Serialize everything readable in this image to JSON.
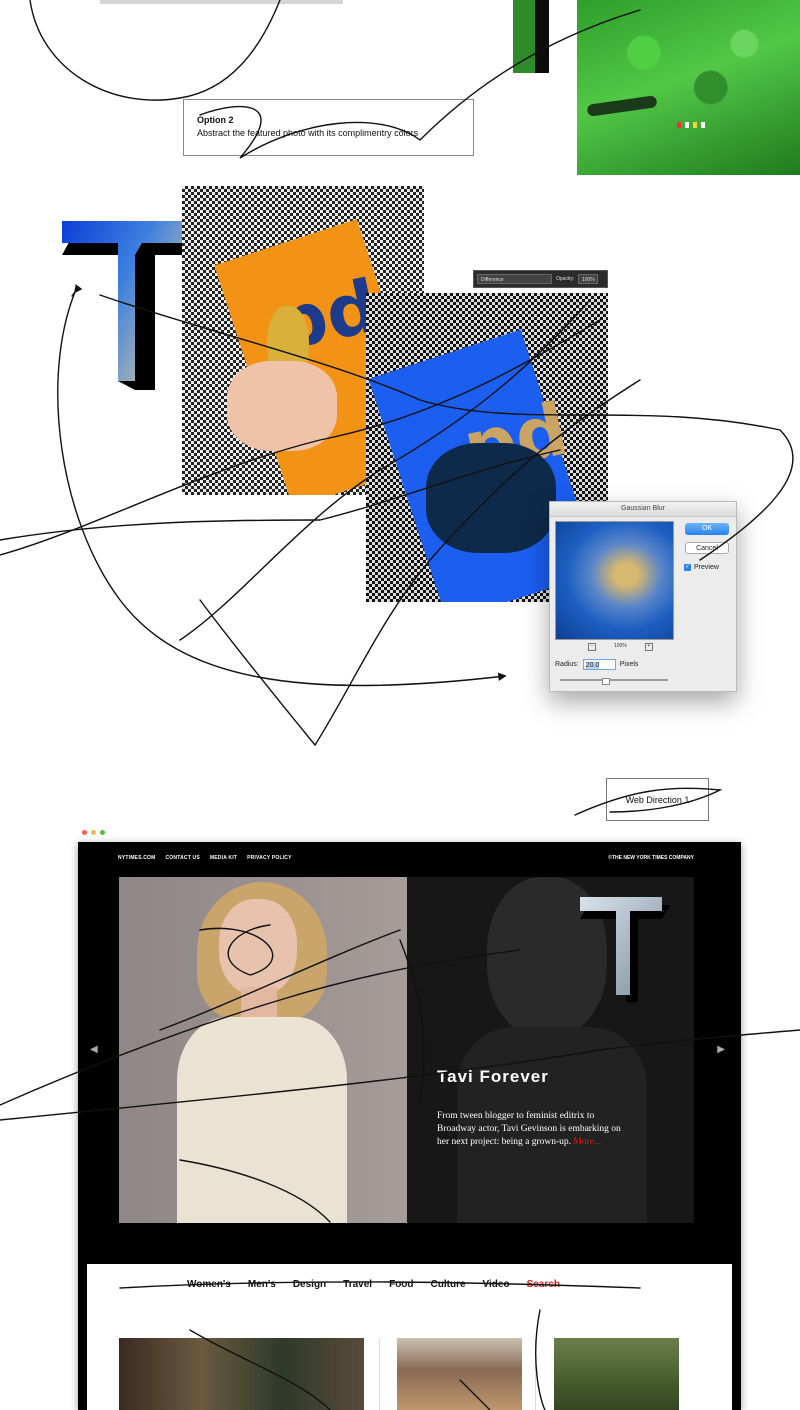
{
  "option": {
    "title": "Option 2",
    "description": "Abstract the featured photo with its complimentry colors"
  },
  "blend_toolbar": {
    "mode": "Difference",
    "opacity_label": "Opacity:",
    "opacity_value": "100%"
  },
  "gaussian_blur": {
    "title": "Gaussian Blur",
    "ok_label": "OK",
    "cancel_label": "Cancel",
    "preview_label": "Preview",
    "zoom": "100%",
    "radius_label": "Radius:",
    "radius_value": "20.0",
    "radius_unit": "Pixels"
  },
  "web_direction_label": "Web Direction 1",
  "browser": {
    "dot_colors": [
      "#fc5b57",
      "#e5bf3c",
      "#57c038"
    ],
    "top_nav": [
      "NYTIMES.COM",
      "CONTACT US",
      "MEDIA KIT",
      "PRIVACY POLICY"
    ],
    "copyright": "©THE NEW YORK TIMES COMPANY",
    "hero": {
      "title": "Tavi Forever",
      "text": "From tween blogger to feminist editrix to Broadway actor, Tavi Gevinson is embarking on her next project: being a grown-up.",
      "more": "More..."
    },
    "nav_items": [
      "Women's",
      "Men's",
      "Design",
      "Travel",
      "Food",
      "Culture",
      "Video"
    ],
    "nav_search": "Search",
    "accent_color": "#d81e1e"
  },
  "icons": {
    "t_logo": "t-logo-icon",
    "arrow_left": "chevron-left-icon",
    "arrow_right": "chevron-right-icon"
  }
}
